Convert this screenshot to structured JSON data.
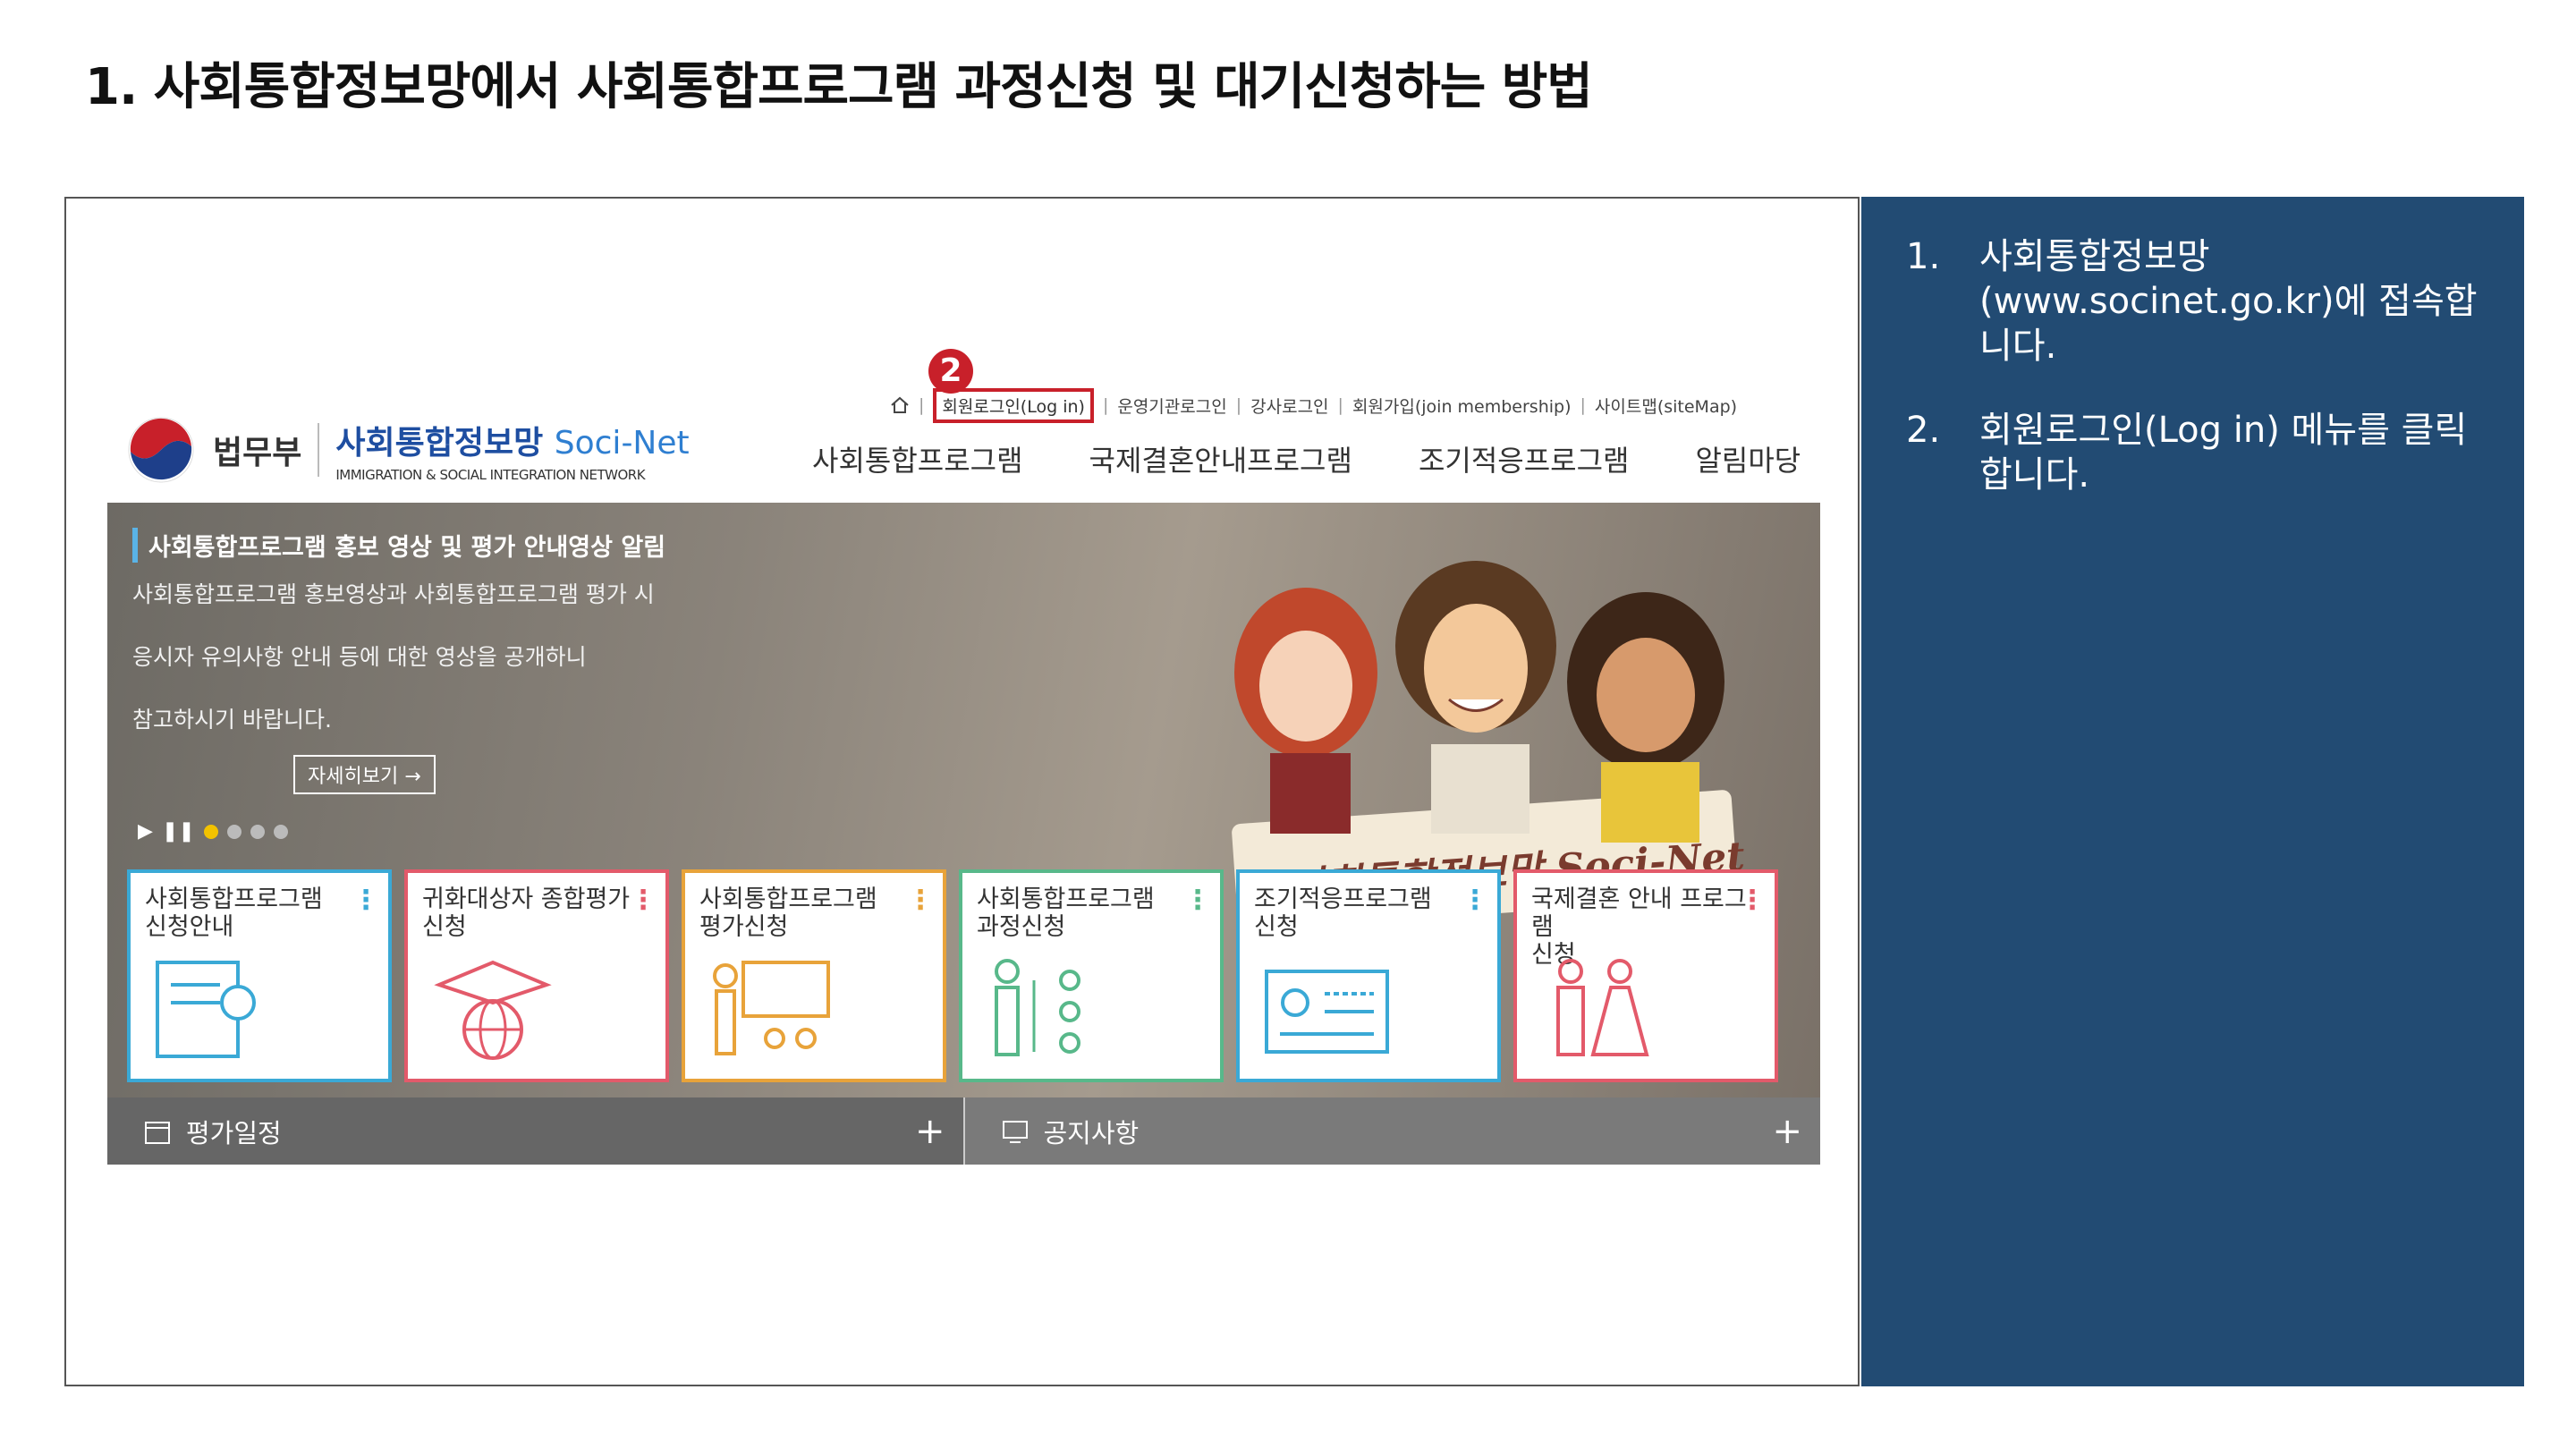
{
  "slide": {
    "title": "1. 사회통합정보망에서 사회통합프로그램 과정신청 및 대기신청하는 방법"
  },
  "panel": {
    "steps": [
      {
        "num": "1.",
        "text": "사회통합정보망 (www.socinet.go.kr)에 접속합니다."
      },
      {
        "num": "2.",
        "text": "회원로그인(Log in) 메뉴를 클릭합니다."
      }
    ],
    "bg_color": "#224b73"
  },
  "site": {
    "badge": "2",
    "util": {
      "login": "회원로그인(Log in)",
      "org_login": "운영기관로그인",
      "teacher_login": "강사로그인",
      "join": "회원가입(join membership)",
      "sitemap": "사이트맵(siteMap)"
    },
    "logo": {
      "ministry": "법무부",
      "name_ko": "사회통합정보망",
      "name_en": "Soci-Net",
      "subtitle": "IMMIGRATION & SOCIAL INTEGRATION NETWORK"
    },
    "nav": [
      "사회통합프로그램",
      "국제결혼안내프로그램",
      "조기적응프로그램",
      "알림마당"
    ],
    "banner": {
      "headline": "사회통합프로그램 홍보 영상 및 평가 안내영상 알림",
      "lines": [
        "사회통합프로그램 홍보영상과 사회통합프로그램 평가 시",
        "응시자 유의사항 안내 등에 대한 영상을 공개하니",
        "참고하시기 바랍니다."
      ],
      "more": "자세히보기 →",
      "illustration_text": "사회통합정보망 Soci-Net"
    },
    "tiles": [
      {
        "label": "사회통합프로그램\n신청안내",
        "color": "#3aa9d6",
        "icon": "book-info-icon"
      },
      {
        "label": "귀화대상자 종합평가\n신청",
        "color": "#e35a6a",
        "icon": "graduation-globe-icon"
      },
      {
        "label": "사회통합프로그램\n평가신청",
        "color": "#e8a33a",
        "icon": "classroom-icon"
      },
      {
        "label": "사회통합프로그램\n과정신청",
        "color": "#58b88a",
        "icon": "checklist-person-icon"
      },
      {
        "label": "조기적응프로그램\n신청",
        "color": "#3aa9d6",
        "icon": "id-card-icon"
      },
      {
        "label": "국제결혼 안내 프로그램\n신청",
        "color": "#e35a6a",
        "icon": "couple-icon"
      }
    ],
    "bottom": [
      {
        "label": "평가일정",
        "icon": "calendar-icon"
      },
      {
        "label": "공지사항",
        "icon": "monitor-icon"
      }
    ],
    "highlight_color": "#c8202a"
  }
}
